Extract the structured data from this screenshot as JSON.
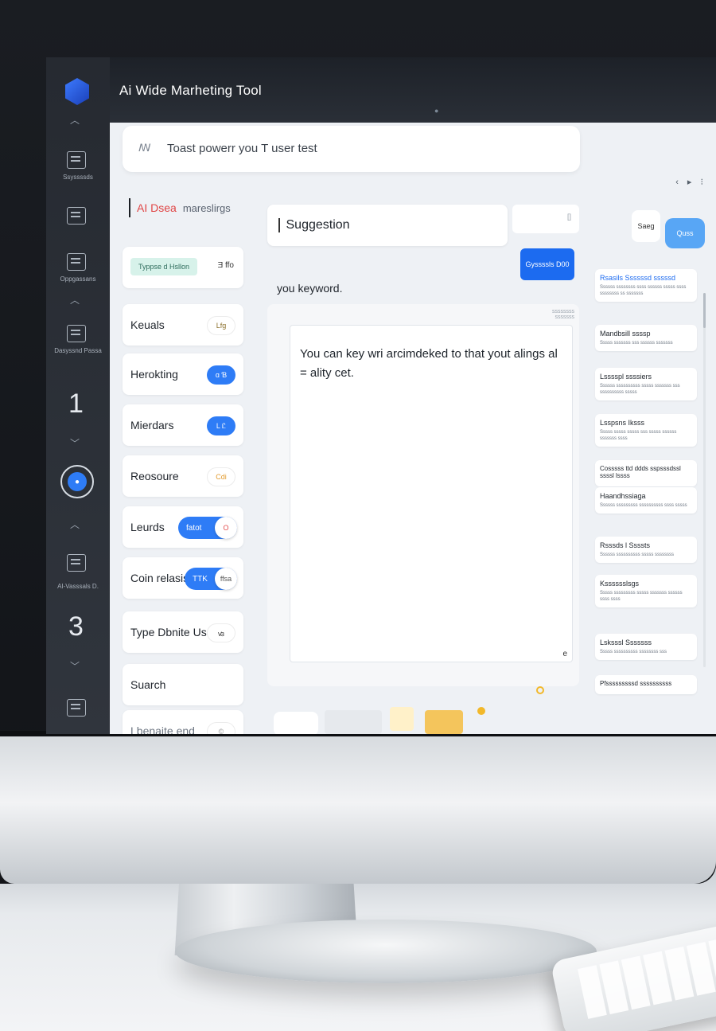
{
  "app": {
    "title": "Ai Wide Marheting Tool"
  },
  "search": {
    "icon": "ai-icon",
    "text": "Toast powerr you T user test"
  },
  "rail": {
    "labels": [
      "Ssyssssds",
      "Oppgassans",
      "Dasyssnd Passa",
      "AI-Vasssals D."
    ],
    "numbers": [
      "1",
      "3"
    ]
  },
  "list": {
    "header_red": "AI Dsea",
    "header_grey": "mareslirgs",
    "tag_text": "Typpse d Hsllon",
    "tag_side": "Ǝ ffo",
    "items": [
      {
        "label": "Keuals",
        "pill": "Lfg"
      },
      {
        "label": "Herokting",
        "pill": "ɑ Ɓ"
      },
      {
        "label": "Mierdars",
        "pill": "L Ꮭ"
      },
      {
        "label": "Reosoure",
        "pill": "Cdi"
      },
      {
        "label": "Leurds",
        "toggle": "fatot",
        "knob": "O"
      },
      {
        "label": "Coin relasis",
        "toggle": "TTK",
        "knob": "ffsa"
      },
      {
        "label": "Type Dbnite Usats",
        "pill": "ꟃ"
      },
      {
        "label": "Suarch"
      },
      {
        "label": "Lbenaite end",
        "pill": "©"
      }
    ]
  },
  "main": {
    "suggestion": "Suggestion",
    "suggestion_right": "[]",
    "generate_button": "Gyssssls D00",
    "keyword_label": "you keyword.",
    "keyword_note": "ssssssss sssssss",
    "editor_text": "You can key wri arcimdeked to that yout alings al\n= ality cet.",
    "editor_corner": "e"
  },
  "right": {
    "save_button": "Saeg",
    "share_button": "Quss",
    "top_icons": "‹ ▸ ⁝",
    "cards": [
      {
        "title": "Rsasils Ssssssd sssssd",
        "sub": "Ssssss ssssssss ssss ssssss sssss ssss ssssssss ss sssssss",
        "blue": true
      },
      {
        "title": "Mandbsill ssssp",
        "sub": "Sssss sssssss sss ssssss sssssss"
      },
      {
        "title": "Lsssspl ssssiers",
        "sub": "Ssssss ssssssssss sssss sssssss sss ssssssssss sssss"
      },
      {
        "title": "Lsspsns Iksss",
        "sub": "Sssss sssss sssss sss sssss ssssss sssssss ssss"
      },
      {
        "title": "Cosssss ttd ddds sspsssdssl ssssl lssss",
        "sub": ""
      },
      {
        "title": "Haandhssiaga",
        "sub": "Ssssss sssssssss ssssssssss ssss sssss"
      },
      {
        "title": "Rsssds l Ssssts",
        "sub": "Ssssss ssssssssss sssss ssssssss"
      },
      {
        "title": "Ksssssslsgs",
        "sub": "Sssss sssssssss sssss sssssss ssssss ssss ssss"
      },
      {
        "title": "Lsksssl Sssssss",
        "sub": "Sssss ssssssssss ssssssss sss"
      },
      {
        "title": "Pfsssssssssd ssssssssss",
        "sub": ""
      }
    ]
  },
  "colors": {
    "accent": "#2e7cf6",
    "rail": "#262a31",
    "highlight_red": "#e04545",
    "tag_green": "#d7f2ea"
  }
}
